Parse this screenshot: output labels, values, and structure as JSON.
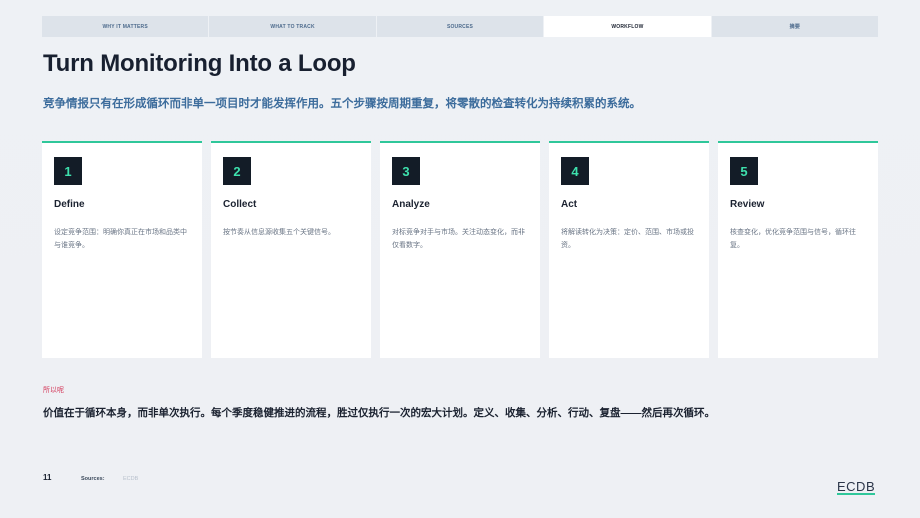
{
  "nav": {
    "tabs": [
      {
        "label": "WHY IT MATTERS",
        "active": false
      },
      {
        "label": "WHAT TO TRACK",
        "active": false
      },
      {
        "label": "SOURCES",
        "active": false
      },
      {
        "label": "WORKFLOW",
        "active": true
      },
      {
        "label": "摘要",
        "active": false
      }
    ]
  },
  "header": {
    "title": "Turn Monitoring Into a Loop",
    "subtitle": "竞争情报只有在形成循环而非单一项目时才能发挥作用。五个步骤按周期重复，将零散的检查转化为持续积累的系统。"
  },
  "steps": [
    {
      "number": "1",
      "title": "Define",
      "description": "设定竞争范围：明确你真正在市场和品类中与谁竞争。"
    },
    {
      "number": "2",
      "title": "Collect",
      "description": "按节奏从信息源收集五个关键信号。"
    },
    {
      "number": "3",
      "title": "Analyze",
      "description": "对标竞争对手与市场。关注动态变化，而非仅看数字。"
    },
    {
      "number": "4",
      "title": "Act",
      "description": "将解读转化为决策：定价、范围、市场或投资。"
    },
    {
      "number": "5",
      "title": "Review",
      "description": "核查变化，优化竞争范围与信号，循环往复。"
    }
  ],
  "so_what": {
    "label": "所以呢",
    "text": "价值在于循环本身，而非单次执行。每个季度稳健推进的流程，胜过仅执行一次的宏大计划。定义、收集、分析、行动、复盘——然后再次循环。"
  },
  "footer": {
    "page_number": "11",
    "sources_label": "Sources:",
    "sources_value": "ECDB",
    "logo": "ECDB"
  },
  "colors": {
    "accent": "#2fc79a",
    "badge_bg": "#131c27",
    "subtitle": "#3c6c9c",
    "so_what_label": "#d4395a"
  }
}
